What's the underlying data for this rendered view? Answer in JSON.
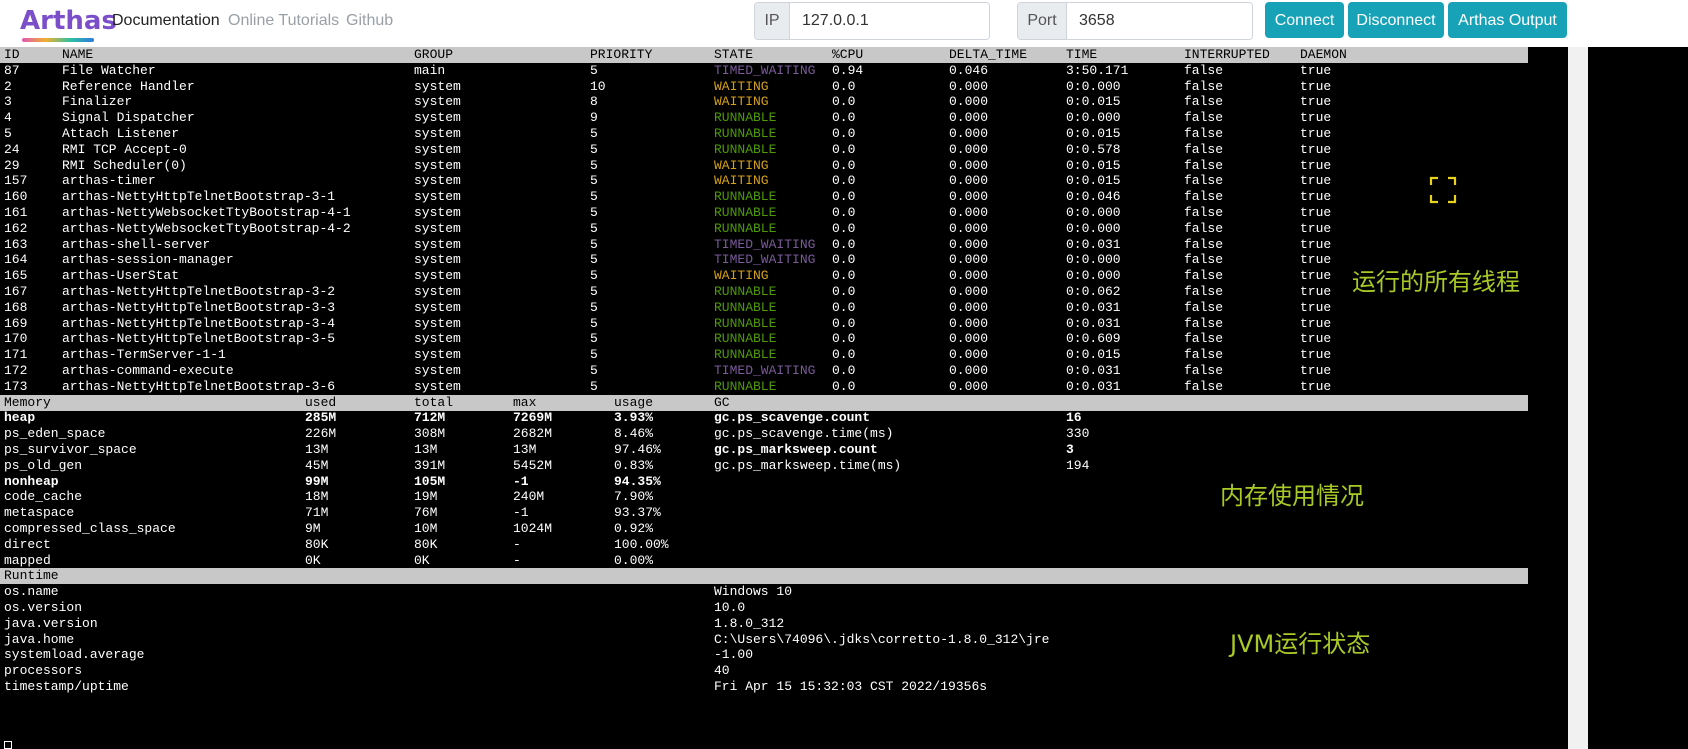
{
  "navbar": {
    "brand": "Arthas",
    "links": [
      "Documentation",
      "Online Tutorials",
      "Github"
    ],
    "ip_label": "IP",
    "ip_value": "127.0.0.1",
    "port_label": "Port",
    "port_value": "3658",
    "buttons": [
      "Connect",
      "Disconnect",
      "Arthas Output"
    ]
  },
  "threads": {
    "headers": [
      "ID",
      "NAME",
      "GROUP",
      "PRIORITY",
      "STATE",
      "%CPU",
      "DELTA_TIME",
      "TIME",
      "INTERRUPTED",
      "DAEMON"
    ],
    "rows": [
      [
        "87",
        "File Watcher",
        "main",
        "5",
        "TIMED_WAITING",
        "0.94",
        "0.046",
        "3:50.171",
        "false",
        "true"
      ],
      [
        "2",
        "Reference Handler",
        "system",
        "10",
        "WAITING",
        "0.0",
        "0.000",
        "0:0.000",
        "false",
        "true"
      ],
      [
        "3",
        "Finalizer",
        "system",
        "8",
        "WAITING",
        "0.0",
        "0.000",
        "0:0.015",
        "false",
        "true"
      ],
      [
        "4",
        "Signal Dispatcher",
        "system",
        "9",
        "RUNNABLE",
        "0.0",
        "0.000",
        "0:0.000",
        "false",
        "true"
      ],
      [
        "5",
        "Attach Listener",
        "system",
        "5",
        "RUNNABLE",
        "0.0",
        "0.000",
        "0:0.015",
        "false",
        "true"
      ],
      [
        "24",
        "RMI TCP Accept-0",
        "system",
        "5",
        "RUNNABLE",
        "0.0",
        "0.000",
        "0:0.578",
        "false",
        "true"
      ],
      [
        "29",
        "RMI Scheduler(0)",
        "system",
        "5",
        "WAITING",
        "0.0",
        "0.000",
        "0:0.015",
        "false",
        "true"
      ],
      [
        "157",
        "arthas-timer",
        "system",
        "5",
        "WAITING",
        "0.0",
        "0.000",
        "0:0.015",
        "false",
        "true"
      ],
      [
        "160",
        "arthas-NettyHttpTelnetBootstrap-3-1",
        "system",
        "5",
        "RUNNABLE",
        "0.0",
        "0.000",
        "0:0.046",
        "false",
        "true"
      ],
      [
        "161",
        "arthas-NettyWebsocketTtyBootstrap-4-1",
        "system",
        "5",
        "RUNNABLE",
        "0.0",
        "0.000",
        "0:0.000",
        "false",
        "true"
      ],
      [
        "162",
        "arthas-NettyWebsocketTtyBootstrap-4-2",
        "system",
        "5",
        "RUNNABLE",
        "0.0",
        "0.000",
        "0:0.000",
        "false",
        "true"
      ],
      [
        "163",
        "arthas-shell-server",
        "system",
        "5",
        "TIMED_WAITING",
        "0.0",
        "0.000",
        "0:0.031",
        "false",
        "true"
      ],
      [
        "164",
        "arthas-session-manager",
        "system",
        "5",
        "TIMED_WAITING",
        "0.0",
        "0.000",
        "0:0.000",
        "false",
        "true"
      ],
      [
        "165",
        "arthas-UserStat",
        "system",
        "5",
        "WAITING",
        "0.0",
        "0.000",
        "0:0.000",
        "false",
        "true"
      ],
      [
        "167",
        "arthas-NettyHttpTelnetBootstrap-3-2",
        "system",
        "5",
        "RUNNABLE",
        "0.0",
        "0.000",
        "0:0.062",
        "false",
        "true"
      ],
      [
        "168",
        "arthas-NettyHttpTelnetBootstrap-3-3",
        "system",
        "5",
        "RUNNABLE",
        "0.0",
        "0.000",
        "0:0.031",
        "false",
        "true"
      ],
      [
        "169",
        "arthas-NettyHttpTelnetBootstrap-3-4",
        "system",
        "5",
        "RUNNABLE",
        "0.0",
        "0.000",
        "0:0.031",
        "false",
        "true"
      ],
      [
        "170",
        "arthas-NettyHttpTelnetBootstrap-3-5",
        "system",
        "5",
        "RUNNABLE",
        "0.0",
        "0.000",
        "0:0.609",
        "false",
        "true"
      ],
      [
        "171",
        "arthas-TermServer-1-1",
        "system",
        "5",
        "RUNNABLE",
        "0.0",
        "0.000",
        "0:0.015",
        "false",
        "true"
      ],
      [
        "172",
        "arthas-command-execute",
        "system",
        "5",
        "TIMED_WAITING",
        "0.0",
        "0.000",
        "0:0.031",
        "false",
        "true"
      ],
      [
        "173",
        "arthas-NettyHttpTelnetBootstrap-3-6",
        "system",
        "5",
        "RUNNABLE",
        "0.0",
        "0.000",
        "0:0.031",
        "false",
        "true"
      ]
    ]
  },
  "memory": {
    "headers": [
      "Memory",
      "used",
      "total",
      "max",
      "usage",
      "GC"
    ],
    "rows": [
      {
        "name": "heap",
        "used": "285M",
        "total": "712M",
        "max": "7269M",
        "usage": "3.93%",
        "bold": true
      },
      {
        "name": "ps_eden_space",
        "used": "226M",
        "total": "308M",
        "max": "2682M",
        "usage": "8.46%",
        "bold": false
      },
      {
        "name": "ps_survivor_space",
        "used": "13M",
        "total": "13M",
        "max": "13M",
        "usage": "97.46%",
        "bold": false
      },
      {
        "name": "ps_old_gen",
        "used": "45M",
        "total": "391M",
        "max": "5452M",
        "usage": "0.83%",
        "bold": false
      },
      {
        "name": "nonheap",
        "used": "99M",
        "total": "105M",
        "max": "-1",
        "usage": "94.35%",
        "bold": true
      },
      {
        "name": "code_cache",
        "used": "18M",
        "total": "19M",
        "max": "240M",
        "usage": "7.90%",
        "bold": false
      },
      {
        "name": "metaspace",
        "used": "71M",
        "total": "76M",
        "max": "-1",
        "usage": "93.37%",
        "bold": false
      },
      {
        "name": "compressed_class_space",
        "used": "9M",
        "total": "10M",
        "max": "1024M",
        "usage": "0.92%",
        "bold": false
      },
      {
        "name": "direct",
        "used": "80K",
        "total": "80K",
        "max": "-",
        "usage": "100.00%",
        "bold": false
      },
      {
        "name": "mapped",
        "used": "0K",
        "total": "0K",
        "max": "-",
        "usage": "0.00%",
        "bold": false
      }
    ],
    "gc": [
      {
        "name": "gc.ps_scavenge.count",
        "value": "16",
        "bold": true
      },
      {
        "name": "gc.ps_scavenge.time(ms)",
        "value": "330",
        "bold": false
      },
      {
        "name": "gc.ps_marksweep.count",
        "value": "3",
        "bold": true
      },
      {
        "name": "gc.ps_marksweep.time(ms)",
        "value": "194",
        "bold": false
      }
    ]
  },
  "runtime": {
    "header": "Runtime",
    "rows": [
      {
        "name": "os.name",
        "value": "Windows 10"
      },
      {
        "name": "os.version",
        "value": "10.0"
      },
      {
        "name": "java.version",
        "value": "1.8.0_312"
      },
      {
        "name": "java.home",
        "value": "C:\\Users\\74096\\.jdks\\corretto-1.8.0_312\\jre"
      },
      {
        "name": "systemload.average",
        "value": "-1.00"
      },
      {
        "name": "processors",
        "value": "40"
      },
      {
        "name": "timestamp/uptime",
        "value": "Fri Apr 15 15:32:03 CST 2022/19356s"
      }
    ]
  },
  "annotations": {
    "threads": "运行的所有线程",
    "memory": "内存使用情况",
    "runtime": "JVM运行状态"
  },
  "colors": {
    "accent": "#17a2b8",
    "annotation": "#a8c926",
    "timed_waiting": "#7a5a99",
    "waiting": "#d4a017",
    "runnable": "#4e9a06"
  }
}
